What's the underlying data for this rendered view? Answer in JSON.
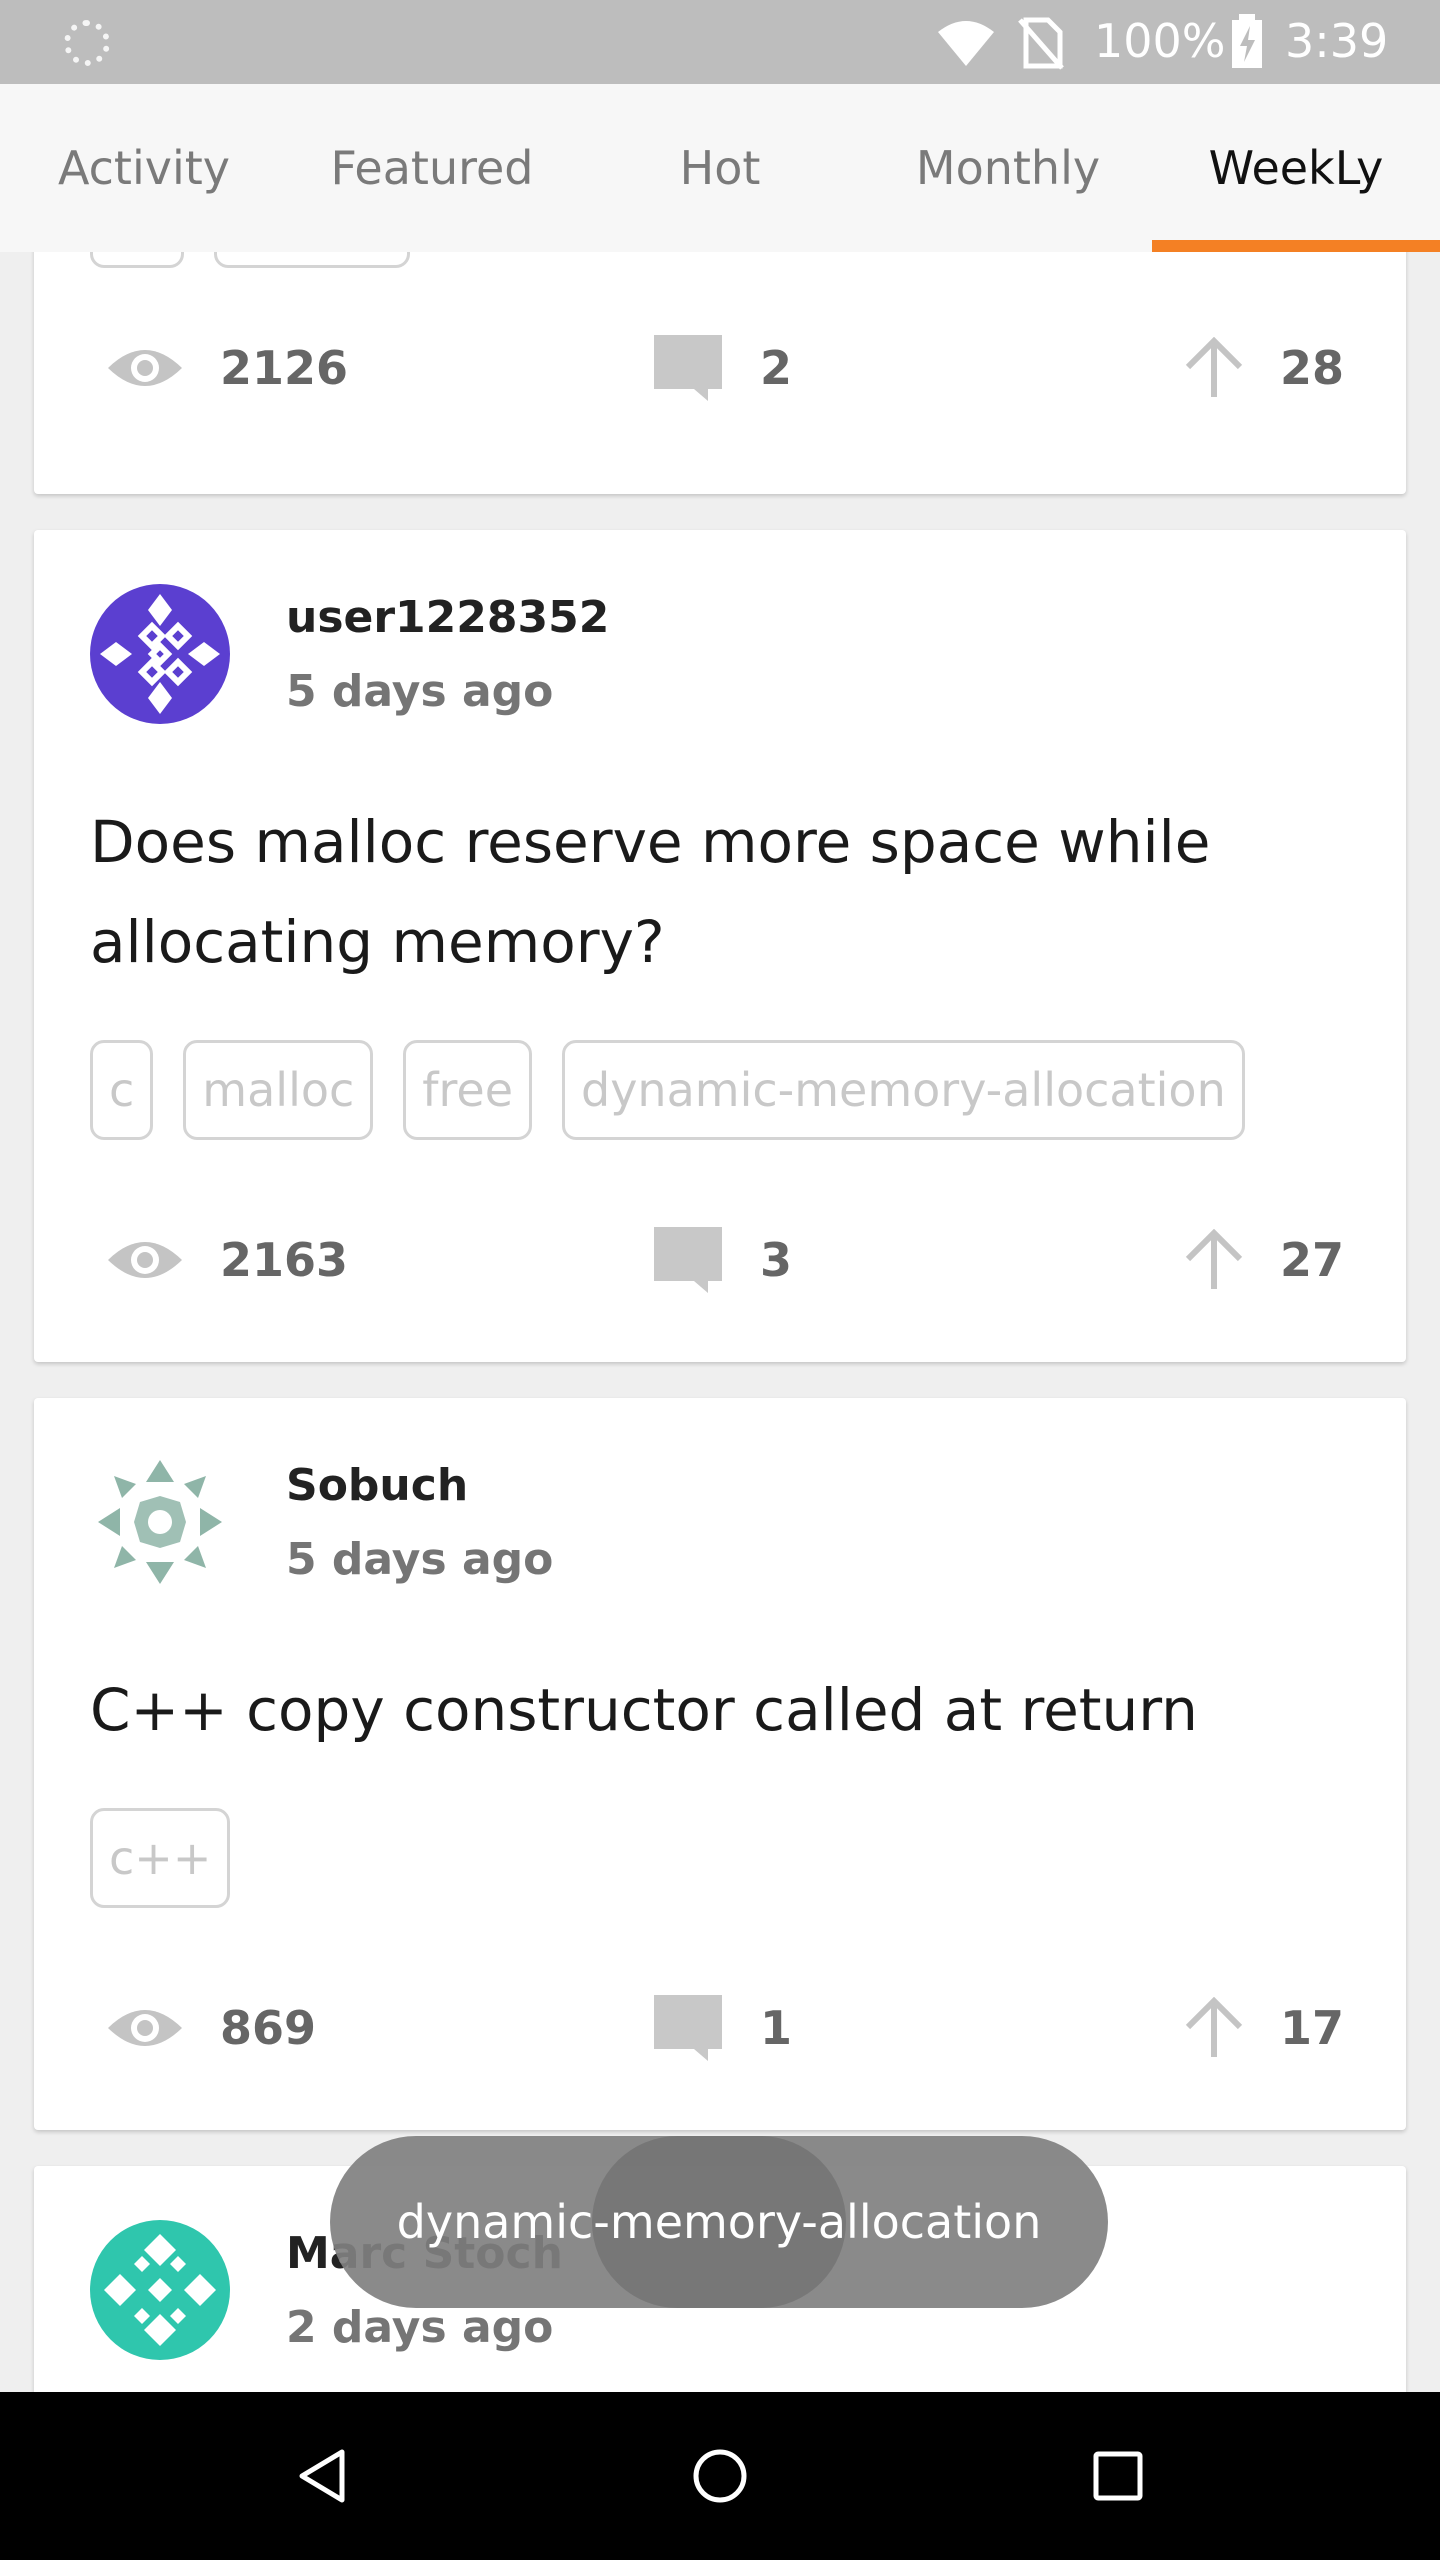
{
  "status_bar": {
    "battery_percent": "100%",
    "time": "3:39"
  },
  "tabs": [
    {
      "label": "Activity",
      "active": false
    },
    {
      "label": "Featured",
      "active": false
    },
    {
      "label": "Hot",
      "active": false
    },
    {
      "label": "Monthly",
      "active": false
    },
    {
      "label": "WeekLy",
      "active": true
    }
  ],
  "accent_color": "#f48024",
  "posts": [
    {
      "views": "2126",
      "comments": "2",
      "votes": "28"
    },
    {
      "user": "user1228352",
      "time": "5 days ago",
      "title": "Does malloc reserve more space while allocating memory?",
      "tags": [
        "c",
        "malloc",
        "free",
        "dynamic-memory-allocation"
      ],
      "views": "2163",
      "comments": "3",
      "votes": "27"
    },
    {
      "user": "Sobuch",
      "time": "5 days ago",
      "title": "C++ copy constructor called at return",
      "tags": [
        "c++"
      ],
      "views": "869",
      "comments": "1",
      "votes": "17"
    },
    {
      "user": "Marc Stoch",
      "time": "2 days ago"
    }
  ],
  "toast": {
    "text": "dynamic-memory-allocation",
    "pressed_text": "free"
  }
}
